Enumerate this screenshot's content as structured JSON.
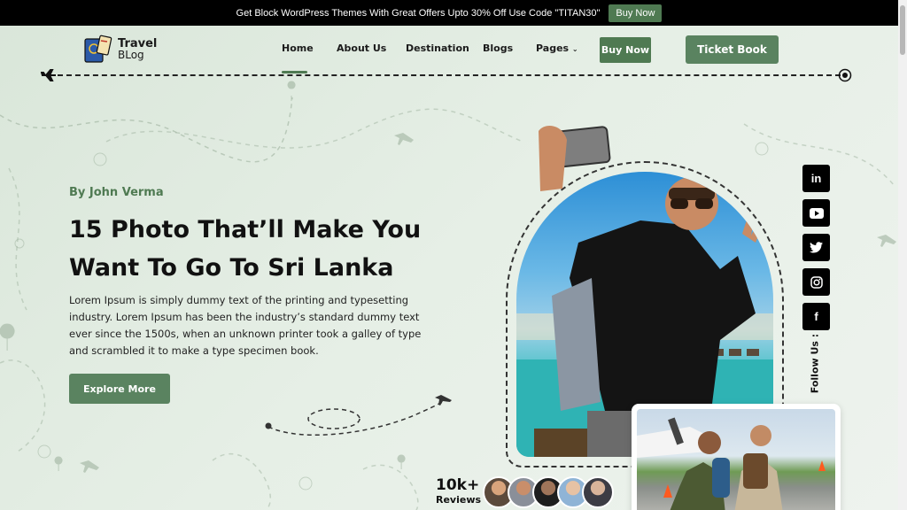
{
  "promo": {
    "text": "Get Block WordPress Themes With Great Offers Upto 30% Off Use Code \"TITAN30\"",
    "button": "Buy Now"
  },
  "logo": {
    "line1": "Travel",
    "line2": "BLog"
  },
  "nav": {
    "items": [
      "Home",
      "About Us",
      "Destination",
      "Blogs",
      "Pages"
    ],
    "buy_now": "Buy Now",
    "ticket_book": "Ticket Book"
  },
  "hero": {
    "author": "By John Verma",
    "title": "15 Photo That’ll Make You Want To Go To Sri Lanka",
    "description": "Lorem Ipsum is simply dummy text of the printing and typesetting industry. Lorem Ipsum has been the industry’s standard dummy text ever since the 1500s, when an unknown printer took a galley of type and scrambled it to make a type specimen book.",
    "cta": "Explore More"
  },
  "social": {
    "icons": [
      "linkedin-icon",
      "youtube-icon",
      "twitter-icon",
      "instagram-icon",
      "facebook-icon"
    ],
    "follow_label": "Follow Us :"
  },
  "reviews": {
    "count": "10k+",
    "label": "Reviews"
  },
  "colors": {
    "accent": "#4f7a52",
    "button": "#5a8360",
    "bg": "#e2ece2"
  }
}
